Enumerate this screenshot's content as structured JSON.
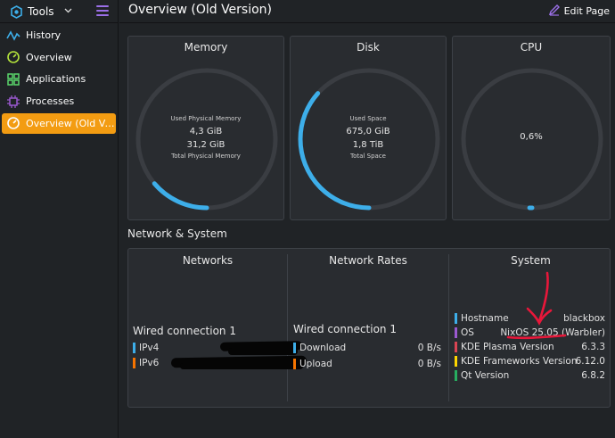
{
  "sidebar": {
    "app_label": "Tools",
    "items": [
      {
        "label": "History",
        "icon": "history-chart-icon",
        "color": "#3daee9"
      },
      {
        "label": "Overview",
        "icon": "overview-gauge-icon",
        "color": "#b5e53c"
      },
      {
        "label": "Applications",
        "icon": "applications-grid-icon",
        "color": "#5ad66b"
      },
      {
        "label": "Processes",
        "icon": "processes-cpu-icon",
        "color": "#9b59d0"
      },
      {
        "label": "Overview (Old Ver...",
        "icon": "overview-old-gauge-icon",
        "color": "#ffffff",
        "active": true
      }
    ],
    "accent_color": "#f39c12"
  },
  "header": {
    "title": "Overview (Old Version)",
    "edit_label": "Edit Page"
  },
  "memory": {
    "title": "Memory",
    "used_label": "Used Physical Memory",
    "used_value": "4,3 GiB",
    "total_value": "31,2 GiB",
    "total_label": "Total Physical Memory",
    "fraction": 0.138
  },
  "disk": {
    "title": "Disk",
    "used_label": "Used Space",
    "used_value": "675,0 GiB",
    "total_value": "1,8 TiB",
    "total_label": "Total Space",
    "fraction": 0.366
  },
  "cpu": {
    "title": "CPU",
    "value": "0,6%",
    "fraction": 0.006
  },
  "section_title": "Network & System",
  "networks": {
    "title": "Networks",
    "connection": "Wired connection 1",
    "rows": [
      {
        "label": "IPv4",
        "color": "#3daee9"
      },
      {
        "label": "IPv6",
        "color": "#f67400"
      }
    ]
  },
  "rates": {
    "title": "Network Rates",
    "connection": "Wired connection 1",
    "rows": [
      {
        "label": "Download",
        "value": "0 B/s",
        "color": "#3daee9"
      },
      {
        "label": "Upload",
        "value": "0 B/s",
        "color": "#f67400"
      }
    ]
  },
  "system": {
    "title": "System",
    "rows": [
      {
        "label": "Hostname",
        "value": "blackbox",
        "color": "#3daee9"
      },
      {
        "label": "OS",
        "value": "NixOS 25.05 (Warbler)",
        "color": "#9b59d0"
      },
      {
        "label": "KDE Plasma Version",
        "value": "6.3.3",
        "color": "#da4453"
      },
      {
        "label": "KDE Frameworks Version",
        "value": "6.12.0",
        "color": "#fdd500"
      },
      {
        "label": "Qt Version",
        "value": "6.8.2",
        "color": "#27ae60"
      }
    ]
  },
  "gauge_color": "#3daee9",
  "annotation_color": "#e8173a"
}
